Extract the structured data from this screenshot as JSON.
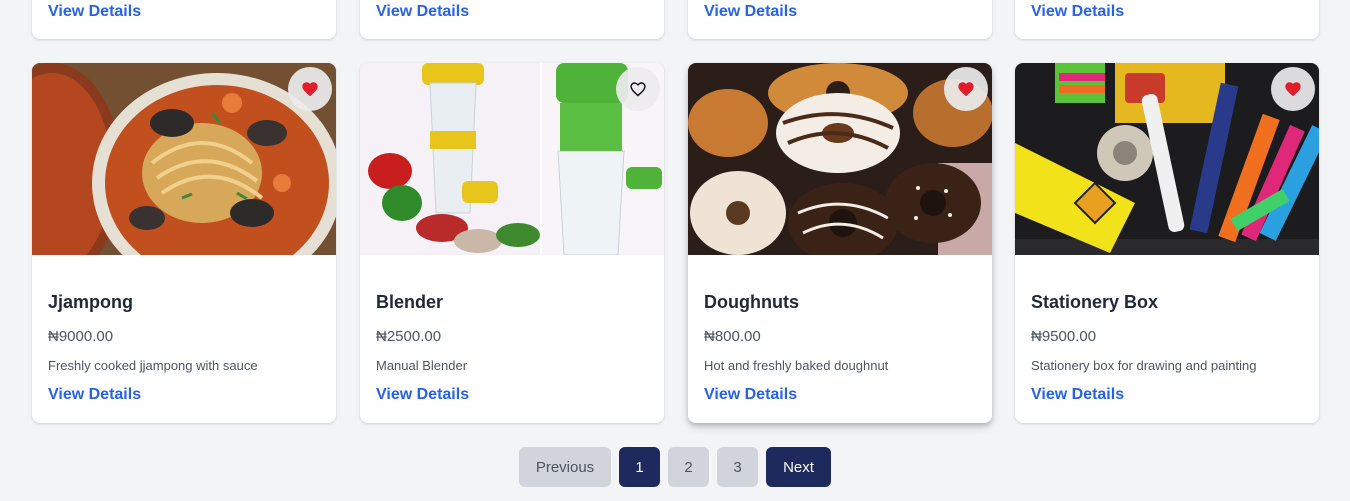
{
  "colors": {
    "accent": "#2563eb",
    "primary_dark": "#1e2a5e",
    "heart": "#e11d2a",
    "muted_button": "#d1d5db"
  },
  "previous_row": [
    {
      "link": "View Details"
    },
    {
      "link": "View Details"
    },
    {
      "link": "View Details"
    },
    {
      "link": "View Details"
    }
  ],
  "products": [
    {
      "title": "Jjampong",
      "price": "₦9000.00",
      "description": "Freshly cooked jjampong with sauce",
      "link": "View Details",
      "favorite_icon": "heart-filled-icon",
      "favorited": true
    },
    {
      "title": "Blender",
      "price": "₦2500.00",
      "description": "Manual Blender",
      "link": "View Details",
      "favorite_icon": "heart-outline-icon",
      "favorited": false
    },
    {
      "title": "Doughnuts",
      "price": "₦800.00",
      "description": "Hot and freshly baked doughnut",
      "link": "View Details",
      "favorite_icon": "heart-filled-icon",
      "favorited": true
    },
    {
      "title": "Stationery Box",
      "price": "₦9500.00",
      "description": "Stationery box for drawing and painting",
      "link": "View Details",
      "favorite_icon": "heart-filled-icon",
      "favorited": true
    }
  ],
  "pagination": {
    "previous": "Previous",
    "pages": [
      "1",
      "2",
      "3"
    ],
    "current_page": "1",
    "next": "Next"
  }
}
